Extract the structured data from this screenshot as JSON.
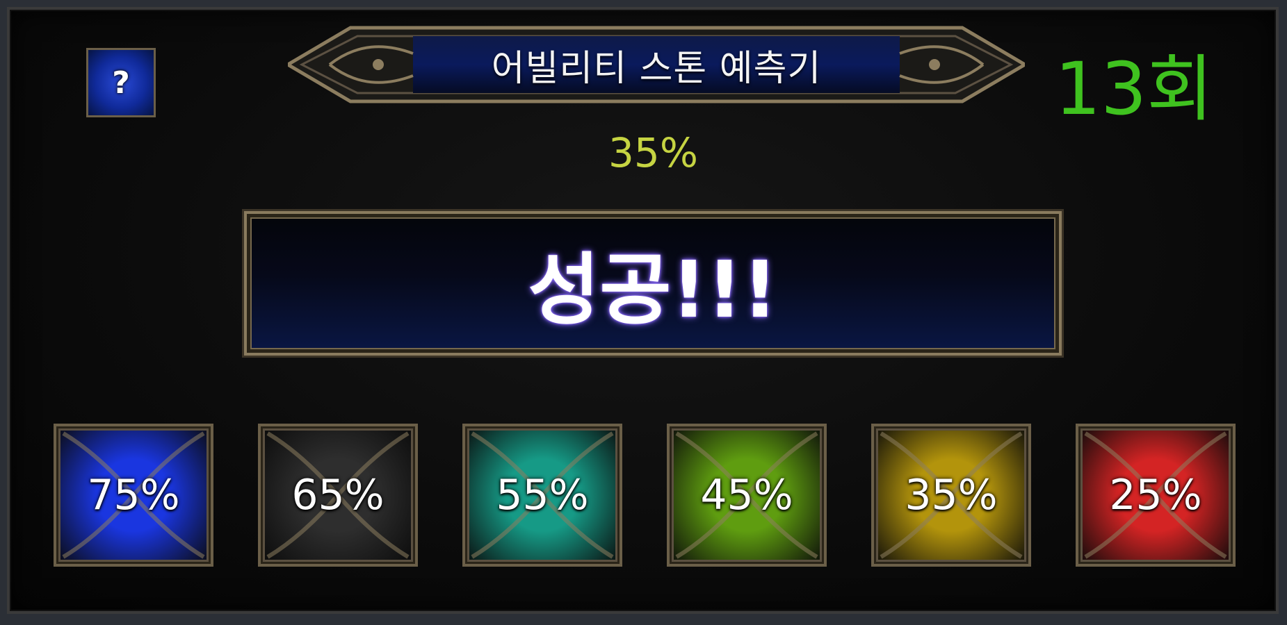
{
  "window": {
    "title": "어빌리티 스톤 예측기"
  },
  "help_button": {
    "label": "?",
    "icon": "question-mark-icon"
  },
  "attempt_count": "13회",
  "current_probability": "35%",
  "result": "성공!!!",
  "colors": {
    "count_green": "#3fc21f",
    "probability_yellow": "#c6d442",
    "result_glow": "#8a6bff",
    "frame_gold": "#8a7b5e"
  },
  "probability_slots": [
    {
      "label": "75%",
      "color": "#1a36e0"
    },
    {
      "label": "65%",
      "color": "#2e2e2e"
    },
    {
      "label": "55%",
      "color": "#169a86"
    },
    {
      "label": "45%",
      "color": "#5f9d10"
    },
    {
      "label": "35%",
      "color": "#b3940c"
    },
    {
      "label": "25%",
      "color": "#d42424"
    }
  ]
}
